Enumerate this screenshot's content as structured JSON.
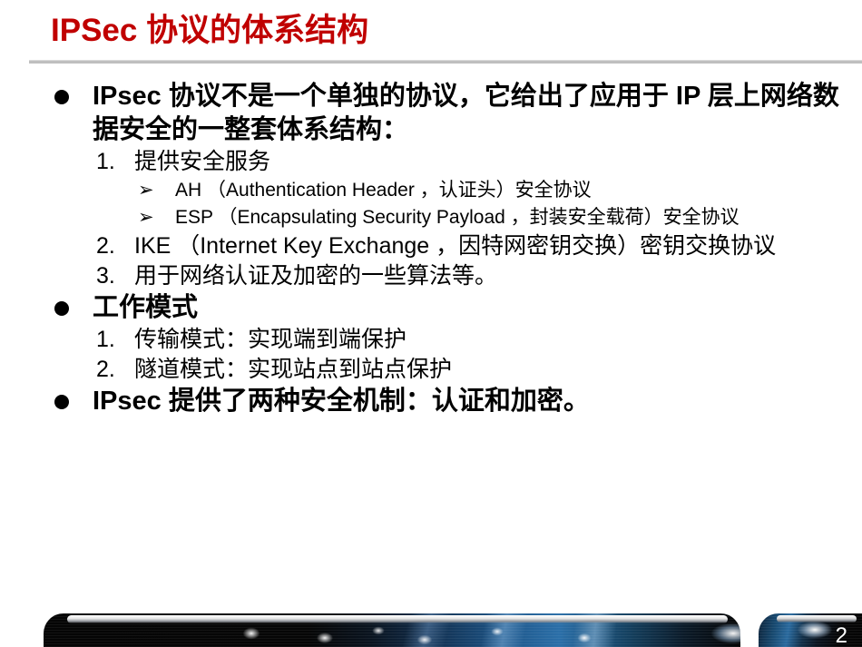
{
  "slide": {
    "title": "IPSec 协议的体系结构",
    "title_color": "#C00000",
    "page_number": "2",
    "background_color": "#FFFFFF",
    "rule_color": "#BFBFBF",
    "bullet_glyph": "●",
    "arrow_glyph": "➢"
  },
  "content": {
    "bullet1": {
      "text": "IPsec 协议不是一个单独的协议，它给出了应用于 IP 层上网络数据安全的一整套体系结构："
    },
    "item1": {
      "num": "1.",
      "text": "提供安全服务"
    },
    "sub1": {
      "arrow": "➢",
      "text": "AH （Authentication Header ，认证头）安全协议"
    },
    "sub2": {
      "arrow": "➢",
      "text": "ESP （Encapsulating Security Payload ，封装安全载荷）安全协议"
    },
    "item2": {
      "num": "2.",
      "text": "IKE （Internet Key Exchange ，因特网密钥交换）密钥交换协议"
    },
    "item3": {
      "num": "3.",
      "text": "用于网络认证及加密的一些算法等。"
    },
    "bullet2": {
      "text": "工作模式"
    },
    "mode1": {
      "num": "1.",
      "text": "传输模式：实现端到端保护"
    },
    "mode2": {
      "num": "2.",
      "text": "隧道模式：实现站点到站点保护"
    },
    "bullet3": {
      "text": "IPsec 提供了两种安全机制：认证和加密。"
    }
  }
}
